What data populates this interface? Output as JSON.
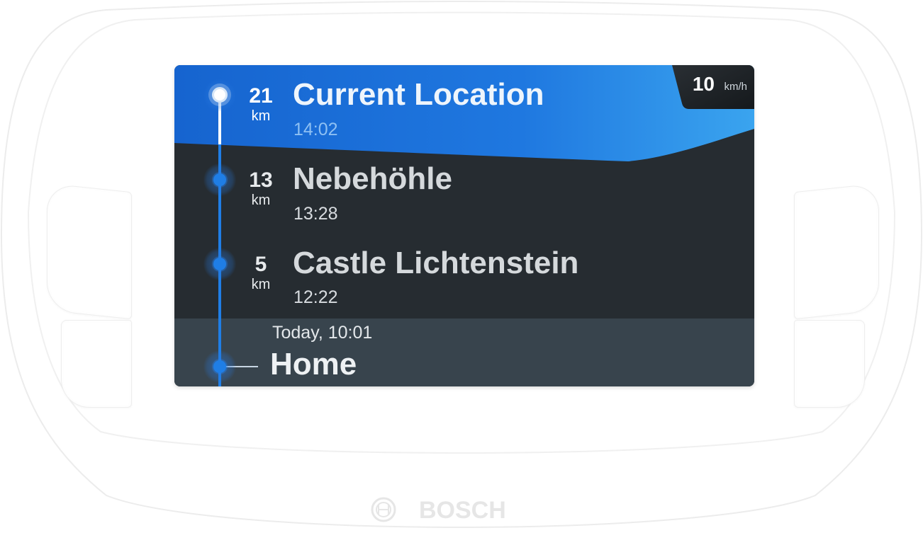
{
  "brand": {
    "name": "BOSCH"
  },
  "speed": {
    "value": "10",
    "unit": "km/h"
  },
  "route": {
    "stops": [
      {
        "distance": "21",
        "unit": "km",
        "name": "Current Location",
        "time": "14:02"
      },
      {
        "distance": "13",
        "unit": "km",
        "name": "Nebehöhle",
        "time": "13:28"
      },
      {
        "distance": "5",
        "unit": "km",
        "name": "Castle Lichtenstein",
        "time": "12:22"
      }
    ],
    "origin": {
      "time": "Today, 10:01",
      "name": "Home"
    }
  },
  "colors": {
    "accent_blue": "#1b6fd8",
    "accent_light_blue": "#3aa0ee",
    "screen_dark": "#262c31",
    "home_band": "#38444d"
  }
}
